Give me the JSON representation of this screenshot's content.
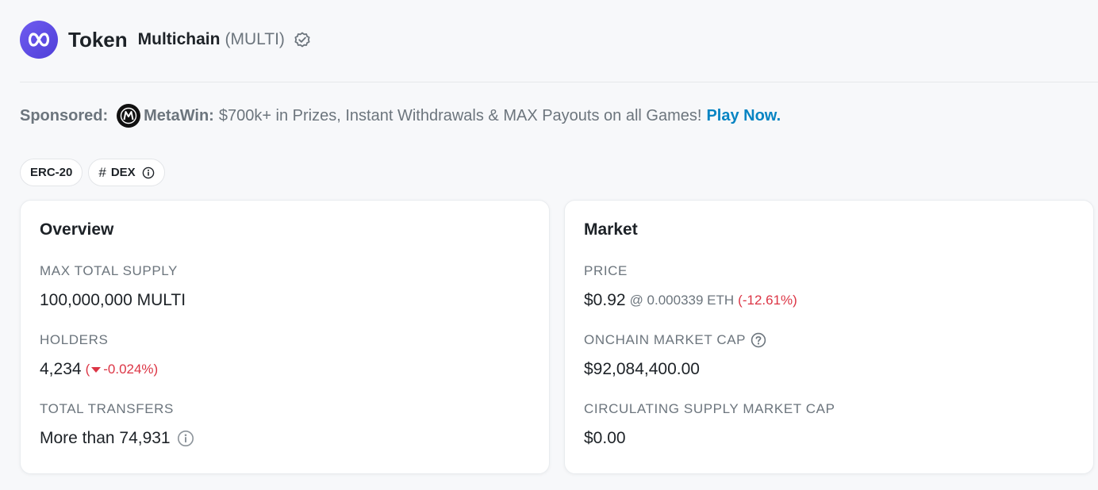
{
  "header": {
    "title": "Token",
    "token_name": "Multichain",
    "token_symbol": "(MULTI)",
    "logo_icon": "multichain-logo-icon",
    "verified_icon": "verified-check-icon"
  },
  "sponsored": {
    "label": "Sponsored:",
    "brand": "MetaWin:",
    "text": "$700k+ in Prizes, Instant Withdrawals & MAX Payouts on all Games!",
    "link": "Play Now."
  },
  "tags": {
    "erc20": "ERC-20",
    "dex": "DEX"
  },
  "overview": {
    "title": "Overview",
    "max_supply_label": "MAX TOTAL SUPPLY",
    "max_supply_value": "100,000,000 MULTI",
    "holders_label": "HOLDERS",
    "holders_value": "4,234",
    "holders_change_open": "(",
    "holders_change": "-0.024%)",
    "transfers_label": "TOTAL TRANSFERS",
    "transfers_value": "More than 74,931"
  },
  "market": {
    "title": "Market",
    "price_label": "PRICE",
    "price_value": "$0.92",
    "price_eth": "@ 0.000339 ETH",
    "price_change": "(-12.61%)",
    "onchain_cap_label": "ONCHAIN MARKET CAP",
    "onchain_cap_value": "$92,084,400.00",
    "circ_cap_label": "CIRCULATING SUPPLY MARKET CAP",
    "circ_cap_value": "$0.00"
  },
  "colors": {
    "accent": "#0784c3",
    "negative": "#dc3545",
    "muted": "#6c757d"
  }
}
